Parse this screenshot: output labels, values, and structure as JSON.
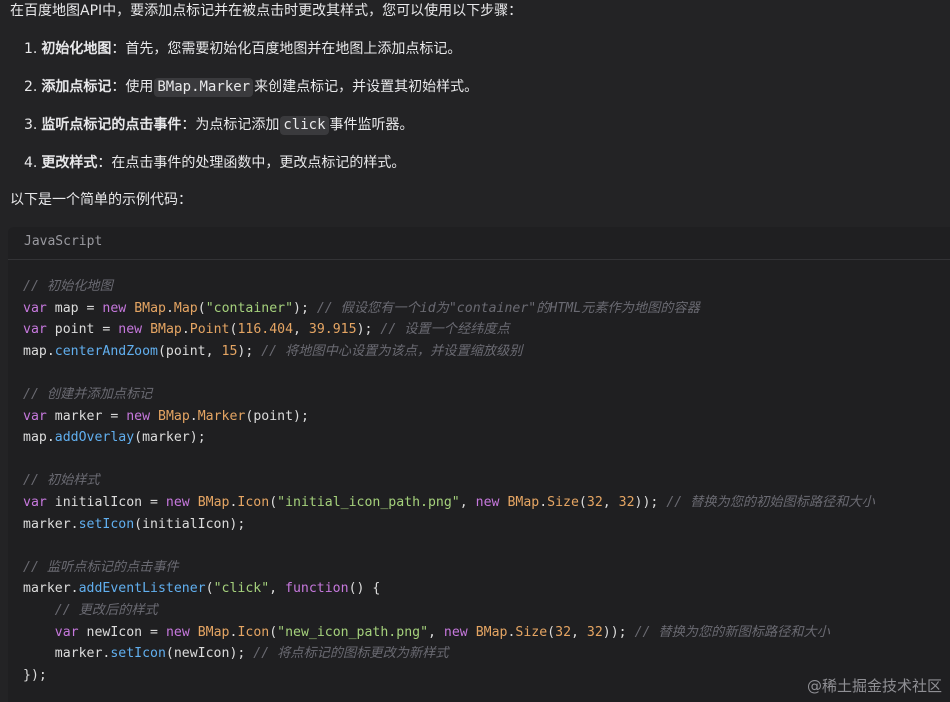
{
  "intro": "在百度地图API中，要添加点标记并在被点击时更改其样式，您可以使用以下步骤：",
  "steps": [
    {
      "num": "1.",
      "title": "初始化地图",
      "text": "：首先，您需要初始化百度地图并在地图上添加点标记。"
    },
    {
      "num": "2.",
      "title": "添加点标记",
      "pre": "：使用",
      "code": "BMap.Marker",
      "post": "来创建点标记，并设置其初始样式。"
    },
    {
      "num": "3.",
      "title": "监听点标记的点击事件",
      "pre": "：为点标记添加",
      "code": "click",
      "post": "事件监听器。"
    },
    {
      "num": "4.",
      "title": "更改样式",
      "text": "：在点击事件的处理函数中，更改点标记的样式。"
    }
  ],
  "summary": "以下是一个简单的示例代码：",
  "code": {
    "language": "JavaScript",
    "lines": [
      [
        [
          "cm",
          "// 初始化地图"
        ]
      ],
      [
        [
          "kw",
          "var"
        ],
        [
          "plain",
          " map = "
        ],
        [
          "kw",
          "new"
        ],
        [
          "plain",
          " "
        ],
        [
          "cls",
          "BMap"
        ],
        [
          "plain",
          "."
        ],
        [
          "cls",
          "Map"
        ],
        [
          "plain",
          "("
        ],
        [
          "str",
          "\"container\""
        ],
        [
          "plain",
          "); "
        ],
        [
          "cm",
          "// 假设您有一个id为\"container\"的HTML元素作为地图的容器"
        ]
      ],
      [
        [
          "kw",
          "var"
        ],
        [
          "plain",
          " point = "
        ],
        [
          "kw",
          "new"
        ],
        [
          "plain",
          " "
        ],
        [
          "cls",
          "BMap"
        ],
        [
          "plain",
          "."
        ],
        [
          "cls",
          "Point"
        ],
        [
          "plain",
          "("
        ],
        [
          "num",
          "116.404"
        ],
        [
          "plain",
          ", "
        ],
        [
          "num",
          "39.915"
        ],
        [
          "plain",
          "); "
        ],
        [
          "cm",
          "// 设置一个经纬度点"
        ]
      ],
      [
        [
          "plain",
          "map."
        ],
        [
          "fn",
          "centerAndZoom"
        ],
        [
          "plain",
          "(point, "
        ],
        [
          "num",
          "15"
        ],
        [
          "plain",
          "); "
        ],
        [
          "cm",
          "// 将地图中心设置为该点，并设置缩放级别"
        ]
      ],
      [],
      [
        [
          "cm",
          "// 创建并添加点标记"
        ]
      ],
      [
        [
          "kw",
          "var"
        ],
        [
          "plain",
          " marker = "
        ],
        [
          "kw",
          "new"
        ],
        [
          "plain",
          " "
        ],
        [
          "cls",
          "BMap"
        ],
        [
          "plain",
          "."
        ],
        [
          "cls",
          "Marker"
        ],
        [
          "plain",
          "(point);"
        ]
      ],
      [
        [
          "plain",
          "map."
        ],
        [
          "fn",
          "addOverlay"
        ],
        [
          "plain",
          "(marker);"
        ]
      ],
      [],
      [
        [
          "cm",
          "// 初始样式"
        ]
      ],
      [
        [
          "kw",
          "var"
        ],
        [
          "plain",
          " initialIcon = "
        ],
        [
          "kw",
          "new"
        ],
        [
          "plain",
          " "
        ],
        [
          "cls",
          "BMap"
        ],
        [
          "plain",
          "."
        ],
        [
          "cls",
          "Icon"
        ],
        [
          "plain",
          "("
        ],
        [
          "str",
          "\"initial_icon_path.png\""
        ],
        [
          "plain",
          ", "
        ],
        [
          "kw",
          "new"
        ],
        [
          "plain",
          " "
        ],
        [
          "cls",
          "BMap"
        ],
        [
          "plain",
          "."
        ],
        [
          "cls",
          "Size"
        ],
        [
          "plain",
          "("
        ],
        [
          "num",
          "32"
        ],
        [
          "plain",
          ", "
        ],
        [
          "num",
          "32"
        ],
        [
          "plain",
          ")); "
        ],
        [
          "cm",
          "// 替换为您的初始图标路径和大小"
        ]
      ],
      [
        [
          "plain",
          "marker."
        ],
        [
          "fn",
          "setIcon"
        ],
        [
          "plain",
          "(initialIcon);"
        ]
      ],
      [],
      [
        [
          "cm",
          "// 监听点标记的点击事件"
        ]
      ],
      [
        [
          "plain",
          "marker."
        ],
        [
          "fn",
          "addEventListener"
        ],
        [
          "plain",
          "("
        ],
        [
          "str",
          "\"click\""
        ],
        [
          "plain",
          ", "
        ],
        [
          "kw",
          "function"
        ],
        [
          "plain",
          "() {"
        ]
      ],
      [
        [
          "plain",
          "    "
        ],
        [
          "cm",
          "// 更改后的样式"
        ]
      ],
      [
        [
          "plain",
          "    "
        ],
        [
          "kw",
          "var"
        ],
        [
          "plain",
          " newIcon = "
        ],
        [
          "kw",
          "new"
        ],
        [
          "plain",
          " "
        ],
        [
          "cls",
          "BMap"
        ],
        [
          "plain",
          "."
        ],
        [
          "cls",
          "Icon"
        ],
        [
          "plain",
          "("
        ],
        [
          "str",
          "\"new_icon_path.png\""
        ],
        [
          "plain",
          ", "
        ],
        [
          "kw",
          "new"
        ],
        [
          "plain",
          " "
        ],
        [
          "cls",
          "BMap"
        ],
        [
          "plain",
          "."
        ],
        [
          "cls",
          "Size"
        ],
        [
          "plain",
          "("
        ],
        [
          "num",
          "32"
        ],
        [
          "plain",
          ", "
        ],
        [
          "num",
          "32"
        ],
        [
          "plain",
          ")); "
        ],
        [
          "cm",
          "// 替换为您的新图标路径和大小"
        ]
      ],
      [
        [
          "plain",
          "    marker."
        ],
        [
          "fn",
          "setIcon"
        ],
        [
          "plain",
          "(newIcon); "
        ],
        [
          "cm",
          "// 将点标记的图标更改为新样式"
        ]
      ],
      [
        [
          "plain",
          "});"
        ]
      ]
    ]
  },
  "watermark": "@稀土掘金技术社区",
  "colors": {
    "background": "#232325",
    "code_background": "#1f1f21",
    "keyword": "#c678dd",
    "class": "#e5a563",
    "function": "#61afef",
    "string": "#a5d17c",
    "number": "#e5a563",
    "comment": "#6a6a72"
  }
}
